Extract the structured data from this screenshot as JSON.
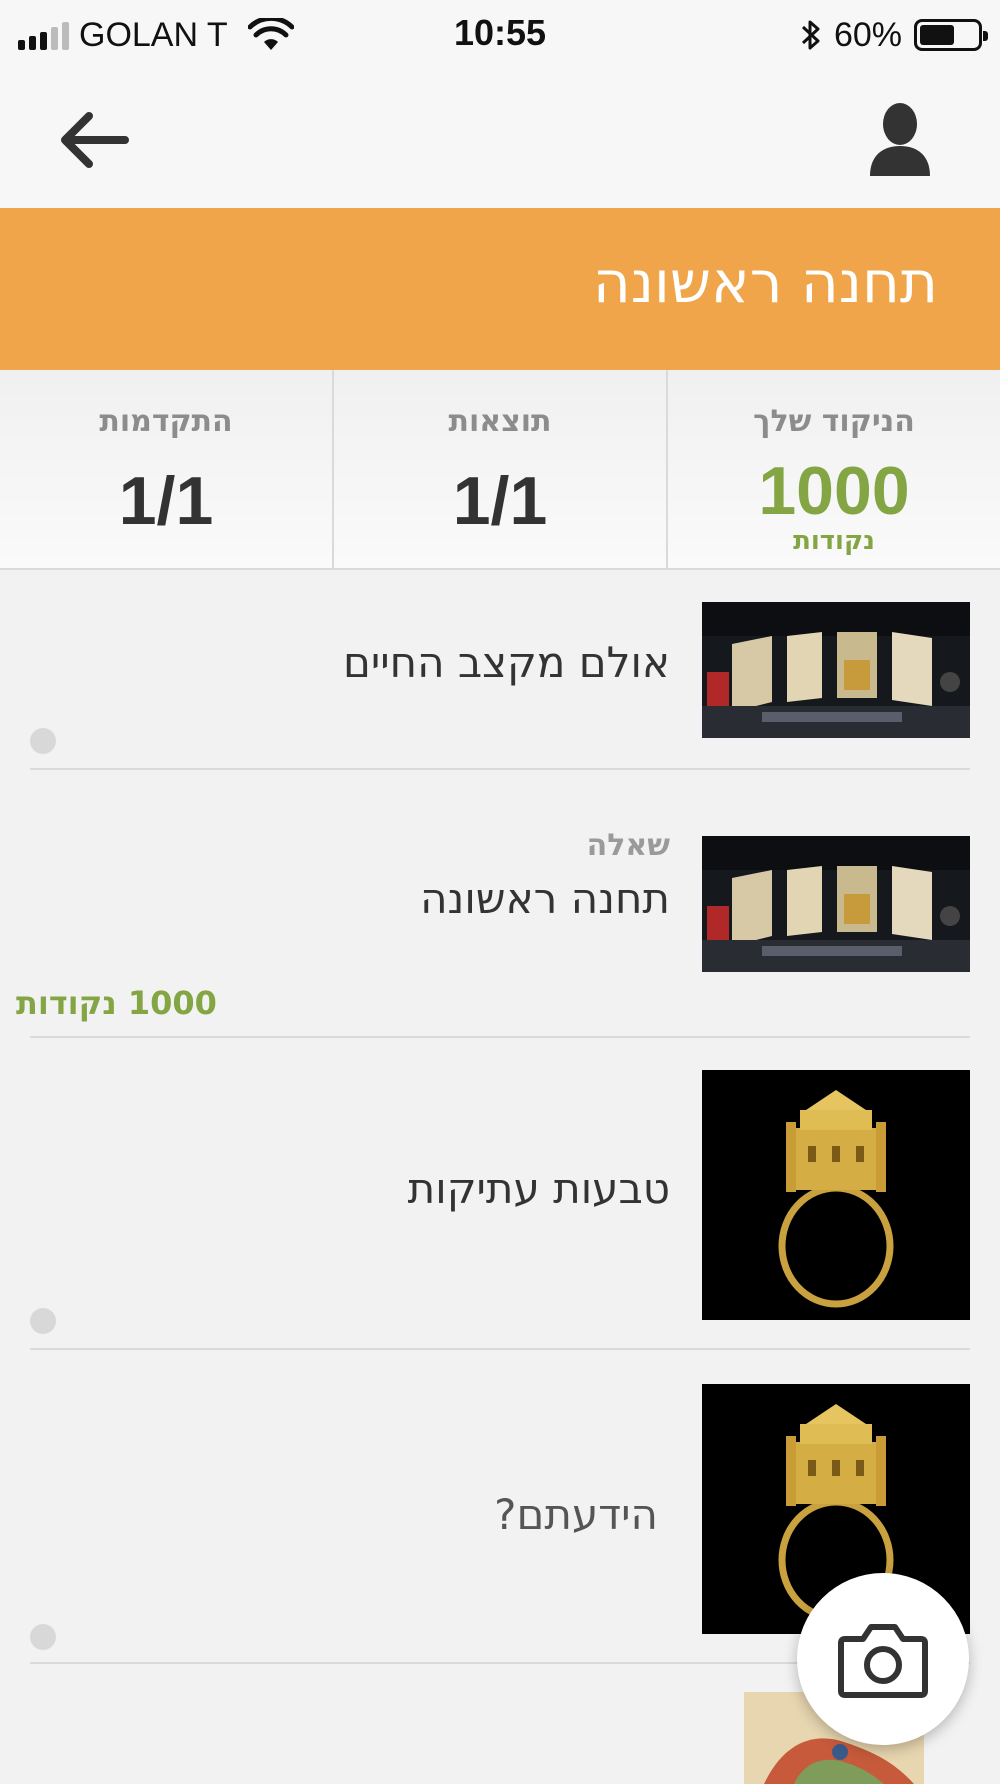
{
  "status_bar": {
    "carrier": "GOLAN T",
    "time": "10:55",
    "battery_percent": "60%",
    "battery_level": 0.6,
    "signal_bars": 3,
    "signal_total": 5
  },
  "navbar": {
    "back_icon": "arrow-left-icon",
    "profile_icon": "user-icon"
  },
  "banner": {
    "title": "תחנה ראשונה",
    "color": "#f0a54a"
  },
  "stats": [
    {
      "label": "התקדמות",
      "value": "1/1"
    },
    {
      "label": "תוצאות",
      "value": "1/1"
    },
    {
      "label": "הניקוד שלך",
      "value": "1000",
      "unit": "נקודות",
      "accent": "#84a544"
    }
  ],
  "items": [
    {
      "title": "אולם מקצב החיים",
      "image": "museum-hall"
    },
    {
      "kicker": "שאלה",
      "title": "תחנה ראשונה",
      "points": "1000 נקודות",
      "image": "museum-hall"
    },
    {
      "title": "טבעות עתיקות",
      "image": "gold-ring"
    },
    {
      "title": "הידעתם?",
      "image": "gold-ring"
    }
  ],
  "camera_button": {
    "icon": "camera-icon"
  }
}
